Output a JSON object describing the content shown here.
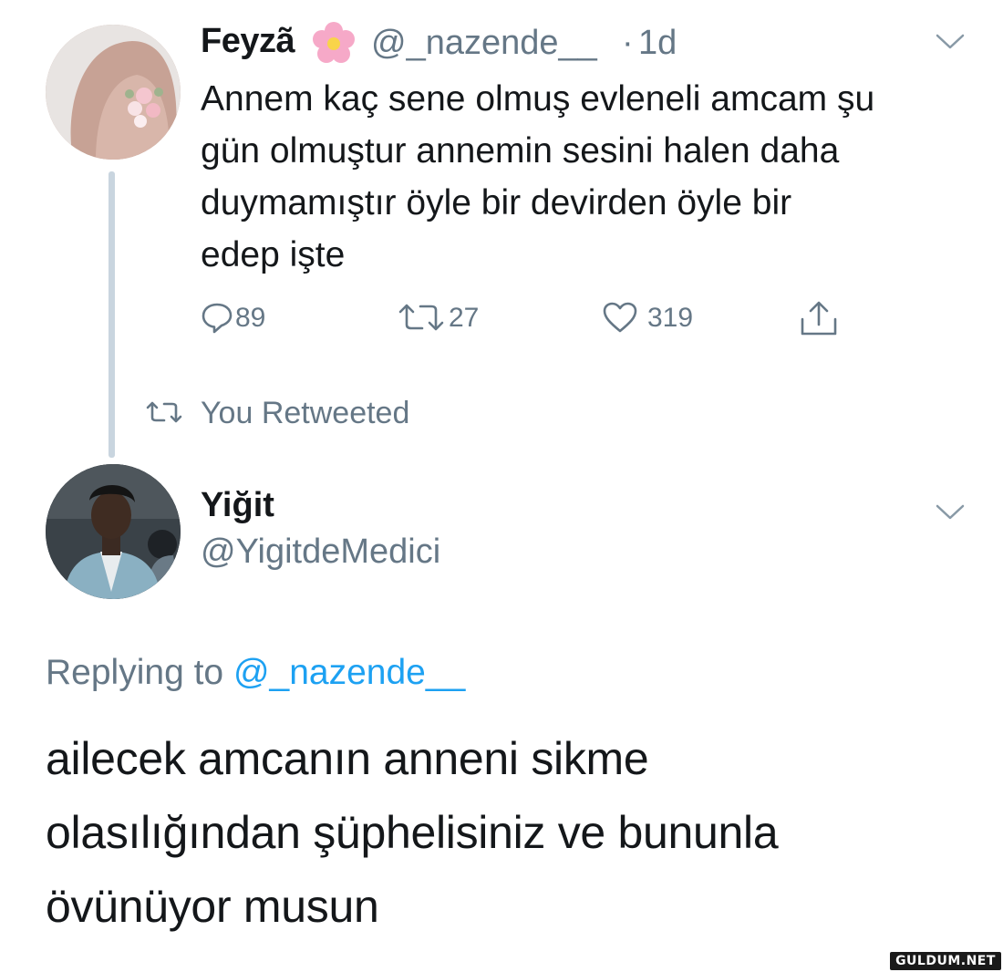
{
  "tweet_original": {
    "display_name": "Feyzã",
    "name_emoji": "flower-emoji",
    "handle": "@_nazende__",
    "separator": "·",
    "time": "1d",
    "text_lines": [
      "Annem kaç sene olmuş evleneli amcam şu",
      "gün olmuştur annemin sesini halen daha",
      "duymamıştır öyle bir devirden öyle bir",
      "edep işte"
    ],
    "actions": {
      "replies": "89",
      "retweets": "27",
      "likes": "319"
    },
    "avatar_icon": "hijab-avatar-icon"
  },
  "retweet_notice": "You Retweeted",
  "tweet_reply": {
    "display_name": "Yiğit",
    "handle": "@YigitdeMedici",
    "replying_prefix": "Replying to ",
    "replying_mention": "@_nazende__",
    "text_lines": [
      "ailecek amcanın anneni sikme",
      "olasılığından şüphelisiniz ve bununla",
      "övünüyor musun"
    ],
    "avatar_icon": "person-avatar-icon"
  },
  "watermark": "GULDUM.NET",
  "colors": {
    "text": "#14171a",
    "secondary": "#657786",
    "link": "#1da1f2",
    "thread_line": "#c9d5df"
  }
}
